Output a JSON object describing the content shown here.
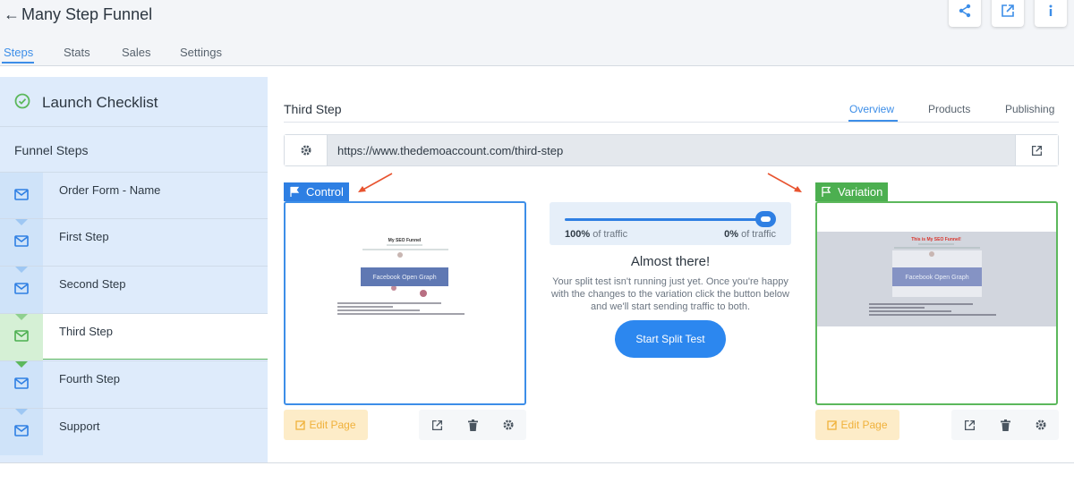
{
  "app": {
    "title": "Many Step Funnel"
  },
  "tabs": [
    {
      "label": "Steps",
      "active": true
    },
    {
      "label": "Stats",
      "active": false
    },
    {
      "label": "Sales",
      "active": false
    },
    {
      "label": "Settings",
      "active": false
    }
  ],
  "sidebar": {
    "checklist_label": "Launch Checklist",
    "section_label": "Funnel Steps",
    "steps": [
      {
        "label": "Order Form - Name"
      },
      {
        "label": "First Step"
      },
      {
        "label": "Second Step"
      },
      {
        "label": "Third Step",
        "active": true
      },
      {
        "label": "Fourth Step"
      },
      {
        "label": "Support"
      }
    ]
  },
  "main": {
    "step_title": "Third Step",
    "subtabs": [
      {
        "label": "Overview",
        "active": true
      },
      {
        "label": "Products"
      },
      {
        "label": "Publishing"
      }
    ],
    "url": "https://www.thedemoaccount.com/third-step"
  },
  "control": {
    "badge": "Control",
    "edit_label": "Edit Page",
    "preview_heading": "My SEO Funnel",
    "preview_banner": "Facebook Open Graph"
  },
  "variation": {
    "badge": "Variation",
    "edit_label": "Edit Page",
    "preview_heading": "This is My SEO Funnel!",
    "preview_banner": "Facebook Open Graph"
  },
  "split_test": {
    "control_pct": "100%",
    "control_suffix": " of traffic",
    "variation_pct": "0%",
    "variation_suffix": " of traffic",
    "control_fraction": 1.0,
    "headline": "Almost there!",
    "message": "Your split test isn't running just yet. Once you're happy with the changes to the variation click the button below and we'll start sending traffic to both.",
    "button_label": "Start Split Test"
  },
  "colors": {
    "accent": "#2e7fe3",
    "control": "#2e7fe3",
    "variation": "#4caf50",
    "edit": "#f0b13b",
    "annotation_arrow": "#e8532f"
  }
}
